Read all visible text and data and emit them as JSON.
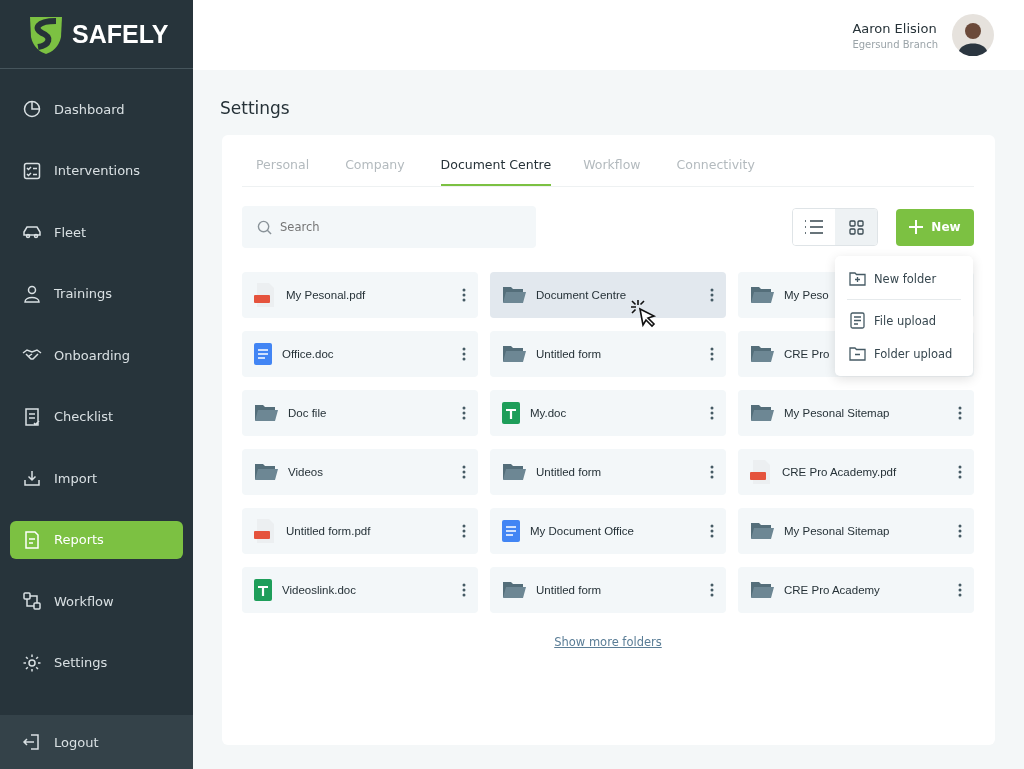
{
  "brand": {
    "name": "SAFELY"
  },
  "sidebar": {
    "items": [
      {
        "label": "Dashboard",
        "selected": false
      },
      {
        "label": "Interventions",
        "selected": false
      },
      {
        "label": "Fleet",
        "selected": false
      },
      {
        "label": "Trainings",
        "selected": false
      },
      {
        "label": "Onboarding",
        "selected": false
      },
      {
        "label": "Checklist",
        "selected": false
      },
      {
        "label": "Import",
        "selected": false
      },
      {
        "label": "Reports",
        "selected": true
      },
      {
        "label": "Workflow",
        "selected": false
      },
      {
        "label": "Settings",
        "selected": false
      }
    ],
    "logout": "Logout"
  },
  "user": {
    "name": "Aaron Elision",
    "branch": "Egersund Branch"
  },
  "page_title": "Settings",
  "tabs": [
    {
      "label": "Personal",
      "selected": false
    },
    {
      "label": "Company",
      "selected": false
    },
    {
      "label": "Document Centre",
      "selected": true
    },
    {
      "label": "Workflow",
      "selected": false
    },
    {
      "label": "Connectivity",
      "selected": false
    }
  ],
  "search": {
    "placeholder": "Search"
  },
  "view_toggle": [
    {
      "kind": "list",
      "selected": false
    },
    {
      "kind": "grid",
      "selected": true
    }
  ],
  "new_button": "New",
  "new_menu": [
    {
      "label": "New folder"
    },
    {
      "label": "File upload"
    },
    {
      "label": "Folder upload"
    }
  ],
  "files": [
    {
      "name": "My Pesonal.pdf",
      "kind": "pdf",
      "selected": false
    },
    {
      "name": "Document Centre",
      "kind": "folder",
      "selected": true
    },
    {
      "name": "My Peso",
      "kind": "folder",
      "selected": false
    },
    {
      "name": "Office.doc",
      "kind": "doc",
      "selected": false
    },
    {
      "name": "Untitled form",
      "kind": "folder",
      "selected": false
    },
    {
      "name": "CRE Pro",
      "kind": "folder",
      "selected": false
    },
    {
      "name": "Doc file",
      "kind": "folder",
      "selected": false
    },
    {
      "name": "My.doc",
      "kind": "sheet",
      "selected": false
    },
    {
      "name": "My Pesonal Sitemap",
      "kind": "folder",
      "selected": false
    },
    {
      "name": "Videos",
      "kind": "folder",
      "selected": false
    },
    {
      "name": "Untitled form",
      "kind": "folder",
      "selected": false
    },
    {
      "name": "CRE Pro Academy.pdf",
      "kind": "pdf",
      "selected": false
    },
    {
      "name": "Untitled form.pdf",
      "kind": "pdf",
      "selected": false
    },
    {
      "name": "My Document Office",
      "kind": "doc",
      "selected": false
    },
    {
      "name": "My Pesonal Sitemap",
      "kind": "folder",
      "selected": false
    },
    {
      "name": "Videoslink.doc",
      "kind": "sheet",
      "selected": false
    },
    {
      "name": "Untitled form",
      "kind": "folder",
      "selected": false
    },
    {
      "name": "CRE Pro Academy",
      "kind": "folder",
      "selected": false
    }
  ],
  "show_more": "Show more folders"
}
